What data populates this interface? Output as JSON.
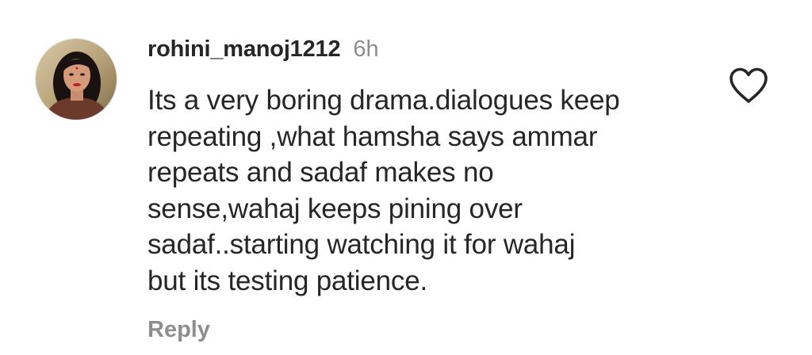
{
  "comment": {
    "username": "rohini_manoj1212",
    "time": "6h",
    "lines": [
      "Its a very boring drama.dialogues keep",
      "repeating ,what hamsha says ammar",
      "repeats and sadaf makes no",
      "sense,wahaj keeps pining over",
      "sadaf..starting watching it for wahaj",
      "but its testing patience."
    ],
    "reply_label": "Reply",
    "like_icon": "heart-outline-icon",
    "avatar_icon": "profile-photo"
  },
  "colors": {
    "text_primary": "#262626",
    "text_secondary": "#8e8e8e",
    "background": "#ffffff"
  }
}
